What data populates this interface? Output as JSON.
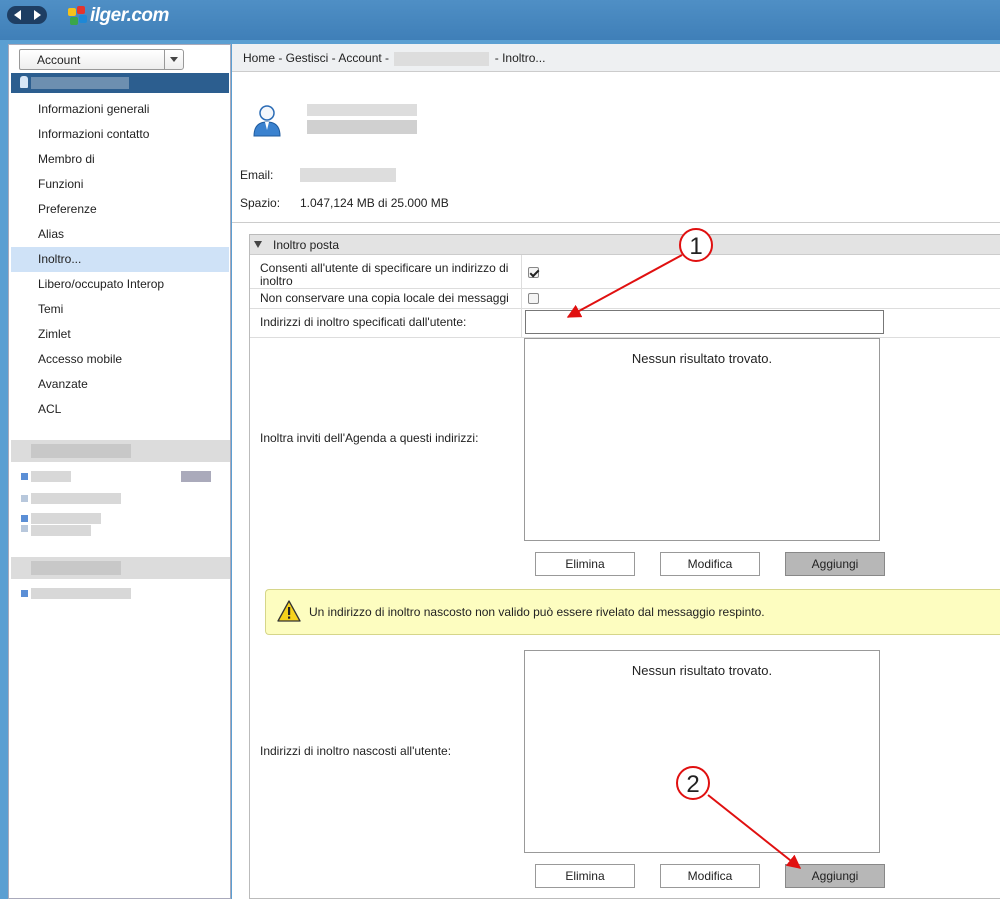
{
  "header": {
    "logo_text": "ilger.com"
  },
  "sidebar": {
    "account_select": "Account",
    "menu": [
      "Informazioni generali",
      "Informazioni contatto",
      "Membro di",
      "Funzioni",
      "Preferenze",
      "Alias",
      "Inoltro...",
      "Libero/occupato Interop",
      "Temi",
      "Zimlet",
      "Accesso mobile",
      "Avanzate",
      "ACL"
    ],
    "active_index": 6
  },
  "breadcrumb": {
    "part1": "Home - Gestisci - Account -",
    "part2": "- Inoltro..."
  },
  "profile": {
    "email_label": "Email:",
    "space_label": "Spazio:",
    "space_value": "1.047,124 MB di 25.000 MB"
  },
  "section": {
    "title": "Inoltro posta",
    "allow_label": "Consenti all'utente di specificare un indirizzo di inoltro",
    "allow_checked": true,
    "nocopy_label": "Non conservare una copia locale dei messaggi",
    "nocopy_checked": false,
    "user_addr_label": "Indirizzi di inoltro specificati dall'utente:",
    "user_addr_value": "",
    "calendar_label": "Inoltra inviti dell'Agenda a questi indirizzi:",
    "calendar_empty": "Nessun risultato trovato.",
    "hidden_label": "Indirizzi di inoltro nascosti all'utente:",
    "hidden_empty": "Nessun risultato trovato.",
    "warning": "Un indirizzo di inoltro nascosto non valido può essere rivelato dal messaggio respinto.",
    "buttons": {
      "delete": "Elimina",
      "edit": "Modifica",
      "add": "Aggiungi"
    }
  },
  "callouts": {
    "one": "1",
    "two": "2"
  },
  "colors": {
    "accent": "#cfe2f7",
    "arrow": "#e01010"
  }
}
